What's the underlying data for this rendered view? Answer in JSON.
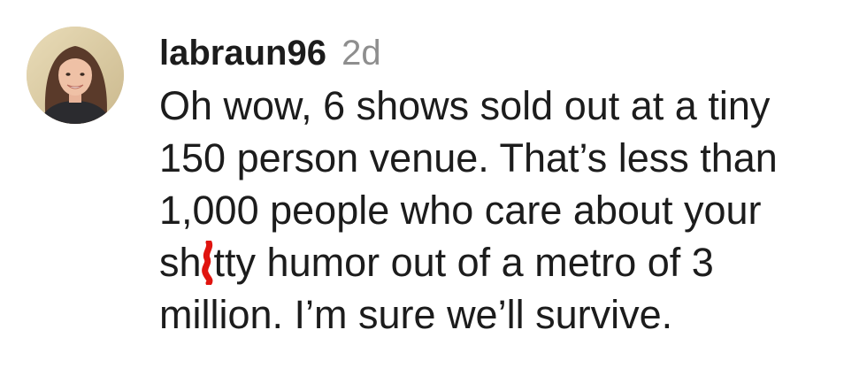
{
  "comment": {
    "username": "labraun96",
    "timestamp": "2d",
    "avatar_icon": "user-avatar-photo",
    "lines": [
      "Oh wow, 6 shows sold out at a tiny",
      "150 person venue. That’s less than",
      "1,000 people who care about your"
    ],
    "censored_line": {
      "before": "sh",
      "after": "tty humor out of a metro of 3",
      "censor_color": "#e0140f"
    },
    "last_line": "million. I’m sure we’ll survive."
  }
}
